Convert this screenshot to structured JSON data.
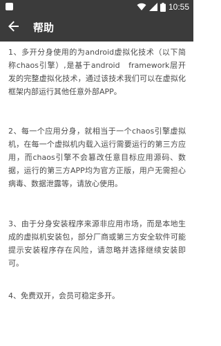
{
  "status_bar": {
    "time": "10:55",
    "icons": [
      "wifi-icon",
      "signal-icon",
      "battery-icon"
    ]
  },
  "app_bar": {
    "back_icon": "arrow-left-icon",
    "title": "帮助"
  },
  "colors": {
    "bar": "#3b3b3b",
    "text": "#4a4a4a",
    "background": "#ffffff"
  },
  "help": {
    "paragraphs": [
      "1、多开分身使用的为android虚拟化技术（以下简称chaos引擎）,是基于android　framework层开发的完整虚拟化技术，通过该技术我们可以在虚拟化框架内部运行其他任意外部APP。",
      "2、每一个应用分身，就相当于一个chaos引擎虚拟机，在每一个虚拟机内载入运行需要运行的第三方应用，而chaos引擎不会篡改任意目标应用源码、数据，运行的第三方APP均为官方正版，用户无需担心病毒、数据泄露等，请放心使用。",
      "3、由于分身安装程序来源非应用市场，而是本地生成的虚拟机安装包，部分厂商或第三方安全软件可能提示安装程序存在风险，请忽略并选择继续安装即可。",
      "4、免费双开，会员可稳定多开。"
    ]
  }
}
